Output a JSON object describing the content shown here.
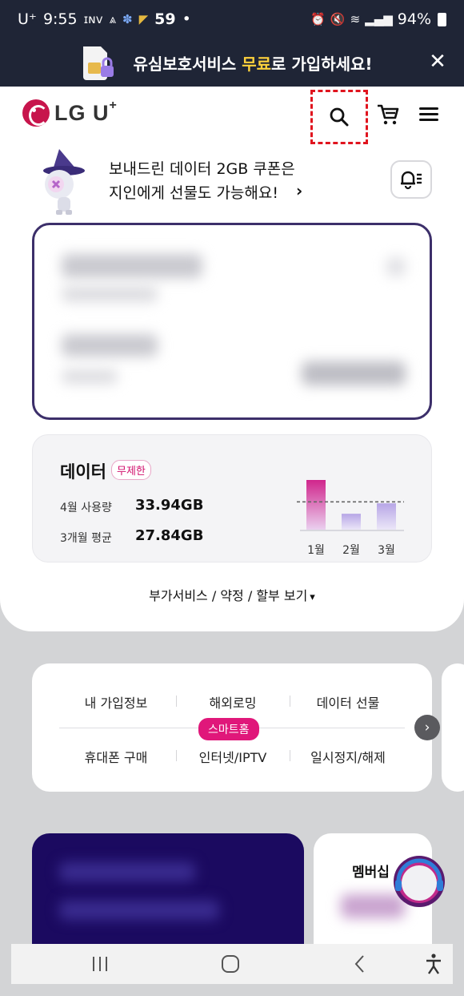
{
  "status_bar": {
    "carrier": "U⁺",
    "time": "9:55",
    "icon_names": [
      "inv-icon",
      "signal-alt-icon",
      "app-icon",
      "app-icon-2"
    ],
    "notification_count": "59",
    "dot": "•",
    "battery": "94%"
  },
  "banner": {
    "text_before": "유심보호서비스 ",
    "text_highlight": "무료",
    "text_after": "로 가입하세요!",
    "highlight_color": "#ffd23c"
  },
  "header": {
    "logo_text": "LG U",
    "logo_plus": "+"
  },
  "coupon": {
    "line1": "보내드린 데이터 2GB 쿠폰은",
    "line2": "지인에게 선물도 가능해요!",
    "arrow": "›"
  },
  "data_card": {
    "title": "데이터",
    "badge": "무제한",
    "rows": [
      {
        "label": "4월 사용량",
        "value": "33.94GB"
      },
      {
        "label": "3개월 평균",
        "value": "27.84GB"
      }
    ],
    "chart_months": [
      "1월",
      "2월",
      "3월"
    ],
    "chart_values": [
      1.0,
      0.32,
      0.53
    ],
    "average_line": 0.56
  },
  "addon_link": "부가서비스 / 약정 / 할부 보기",
  "quick_menu": {
    "row1": [
      "내 가입정보",
      "해외로밍",
      "데이터 선물"
    ],
    "row2": [
      "휴대폰 구매",
      "인터넷/IPTV",
      "일시정지/해제"
    ],
    "badge": "스마트홈"
  },
  "membership": {
    "title": "멤버십"
  },
  "colors": {
    "brand": "#c7154c",
    "accent_pink": "#e0177a",
    "dark_navy": "#1f2536",
    "card_purple": "#3c2f6a"
  }
}
